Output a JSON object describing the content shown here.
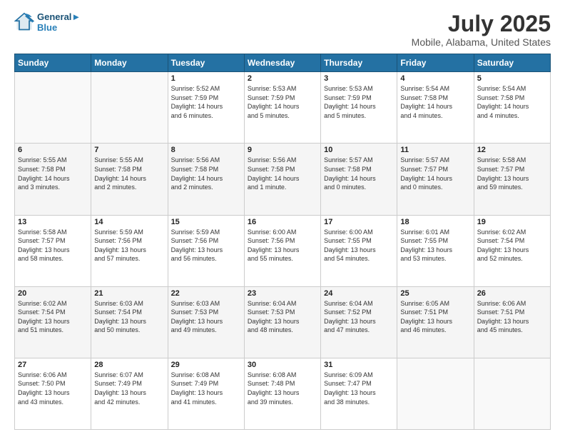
{
  "header": {
    "logo_line1": "General",
    "logo_line2": "Blue",
    "title": "July 2025",
    "subtitle": "Mobile, Alabama, United States"
  },
  "columns": [
    "Sunday",
    "Monday",
    "Tuesday",
    "Wednesday",
    "Thursday",
    "Friday",
    "Saturday"
  ],
  "weeks": [
    [
      {
        "day": "",
        "info": ""
      },
      {
        "day": "",
        "info": ""
      },
      {
        "day": "1",
        "info": "Sunrise: 5:52 AM\nSunset: 7:59 PM\nDaylight: 14 hours\nand 6 minutes."
      },
      {
        "day": "2",
        "info": "Sunrise: 5:53 AM\nSunset: 7:59 PM\nDaylight: 14 hours\nand 5 minutes."
      },
      {
        "day": "3",
        "info": "Sunrise: 5:53 AM\nSunset: 7:59 PM\nDaylight: 14 hours\nand 5 minutes."
      },
      {
        "day": "4",
        "info": "Sunrise: 5:54 AM\nSunset: 7:58 PM\nDaylight: 14 hours\nand 4 minutes."
      },
      {
        "day": "5",
        "info": "Sunrise: 5:54 AM\nSunset: 7:58 PM\nDaylight: 14 hours\nand 4 minutes."
      }
    ],
    [
      {
        "day": "6",
        "info": "Sunrise: 5:55 AM\nSunset: 7:58 PM\nDaylight: 14 hours\nand 3 minutes."
      },
      {
        "day": "7",
        "info": "Sunrise: 5:55 AM\nSunset: 7:58 PM\nDaylight: 14 hours\nand 2 minutes."
      },
      {
        "day": "8",
        "info": "Sunrise: 5:56 AM\nSunset: 7:58 PM\nDaylight: 14 hours\nand 2 minutes."
      },
      {
        "day": "9",
        "info": "Sunrise: 5:56 AM\nSunset: 7:58 PM\nDaylight: 14 hours\nand 1 minute."
      },
      {
        "day": "10",
        "info": "Sunrise: 5:57 AM\nSunset: 7:58 PM\nDaylight: 14 hours\nand 0 minutes."
      },
      {
        "day": "11",
        "info": "Sunrise: 5:57 AM\nSunset: 7:57 PM\nDaylight: 14 hours\nand 0 minutes."
      },
      {
        "day": "12",
        "info": "Sunrise: 5:58 AM\nSunset: 7:57 PM\nDaylight: 13 hours\nand 59 minutes."
      }
    ],
    [
      {
        "day": "13",
        "info": "Sunrise: 5:58 AM\nSunset: 7:57 PM\nDaylight: 13 hours\nand 58 minutes."
      },
      {
        "day": "14",
        "info": "Sunrise: 5:59 AM\nSunset: 7:56 PM\nDaylight: 13 hours\nand 57 minutes."
      },
      {
        "day": "15",
        "info": "Sunrise: 5:59 AM\nSunset: 7:56 PM\nDaylight: 13 hours\nand 56 minutes."
      },
      {
        "day": "16",
        "info": "Sunrise: 6:00 AM\nSunset: 7:56 PM\nDaylight: 13 hours\nand 55 minutes."
      },
      {
        "day": "17",
        "info": "Sunrise: 6:00 AM\nSunset: 7:55 PM\nDaylight: 13 hours\nand 54 minutes."
      },
      {
        "day": "18",
        "info": "Sunrise: 6:01 AM\nSunset: 7:55 PM\nDaylight: 13 hours\nand 53 minutes."
      },
      {
        "day": "19",
        "info": "Sunrise: 6:02 AM\nSunset: 7:54 PM\nDaylight: 13 hours\nand 52 minutes."
      }
    ],
    [
      {
        "day": "20",
        "info": "Sunrise: 6:02 AM\nSunset: 7:54 PM\nDaylight: 13 hours\nand 51 minutes."
      },
      {
        "day": "21",
        "info": "Sunrise: 6:03 AM\nSunset: 7:54 PM\nDaylight: 13 hours\nand 50 minutes."
      },
      {
        "day": "22",
        "info": "Sunrise: 6:03 AM\nSunset: 7:53 PM\nDaylight: 13 hours\nand 49 minutes."
      },
      {
        "day": "23",
        "info": "Sunrise: 6:04 AM\nSunset: 7:53 PM\nDaylight: 13 hours\nand 48 minutes."
      },
      {
        "day": "24",
        "info": "Sunrise: 6:04 AM\nSunset: 7:52 PM\nDaylight: 13 hours\nand 47 minutes."
      },
      {
        "day": "25",
        "info": "Sunrise: 6:05 AM\nSunset: 7:51 PM\nDaylight: 13 hours\nand 46 minutes."
      },
      {
        "day": "26",
        "info": "Sunrise: 6:06 AM\nSunset: 7:51 PM\nDaylight: 13 hours\nand 45 minutes."
      }
    ],
    [
      {
        "day": "27",
        "info": "Sunrise: 6:06 AM\nSunset: 7:50 PM\nDaylight: 13 hours\nand 43 minutes."
      },
      {
        "day": "28",
        "info": "Sunrise: 6:07 AM\nSunset: 7:49 PM\nDaylight: 13 hours\nand 42 minutes."
      },
      {
        "day": "29",
        "info": "Sunrise: 6:08 AM\nSunset: 7:49 PM\nDaylight: 13 hours\nand 41 minutes."
      },
      {
        "day": "30",
        "info": "Sunrise: 6:08 AM\nSunset: 7:48 PM\nDaylight: 13 hours\nand 39 minutes."
      },
      {
        "day": "31",
        "info": "Sunrise: 6:09 AM\nSunset: 7:47 PM\nDaylight: 13 hours\nand 38 minutes."
      },
      {
        "day": "",
        "info": ""
      },
      {
        "day": "",
        "info": ""
      }
    ]
  ]
}
